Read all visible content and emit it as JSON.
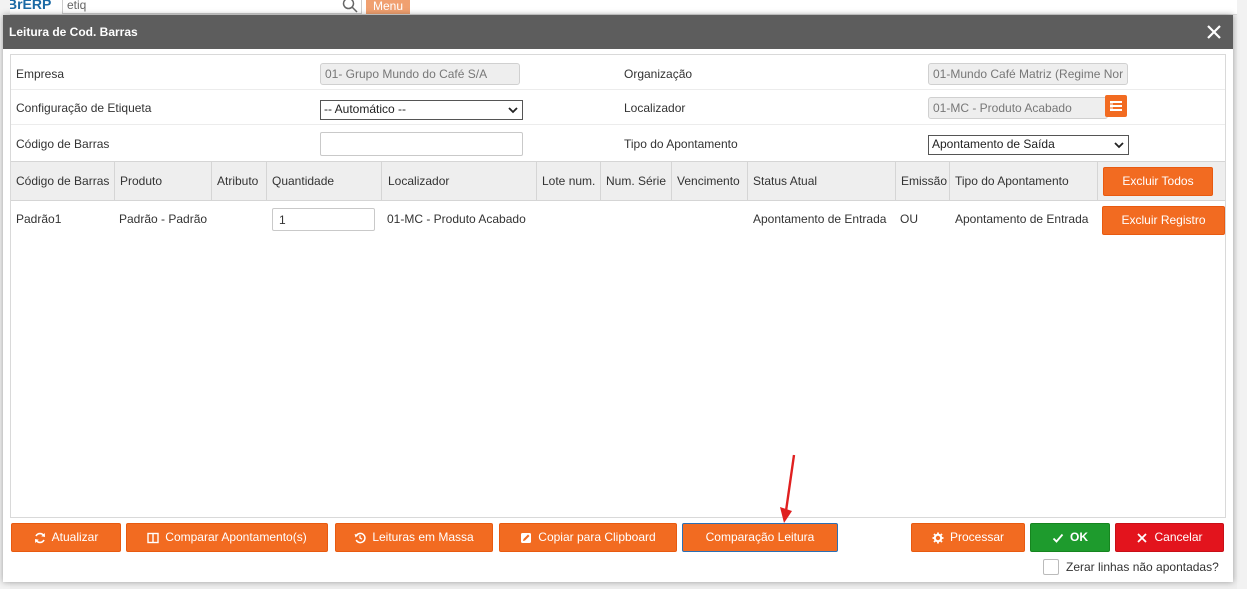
{
  "background": {
    "logo": "BrERP",
    "search_value": "etiq",
    "menu_label": "Menu"
  },
  "dialog": {
    "title": "Leitura de Cod. Barras",
    "close_icon": "close-icon"
  },
  "form": {
    "empresa_label": "Empresa",
    "empresa_value": "01- Grupo Mundo do Café S/A",
    "organizacao_label": "Organização",
    "organizacao_value": "01-Mundo Café Matriz (Regime Nor",
    "config_etiqueta_label": "Configuração de Etiqueta",
    "config_etiqueta_value": "-- Automático --",
    "localizador_label": "Localizador",
    "localizador_value": "01-MC - Produto Acabado",
    "localizador_button_icon": "list-icon",
    "codigo_barras_label": "Código de Barras",
    "codigo_barras_value": "",
    "tipo_apontamento_label": "Tipo do Apontamento",
    "tipo_apontamento_value": "Apontamento de Saída"
  },
  "table": {
    "columns": [
      "Código de Barras",
      "Produto",
      "Atributo",
      "Quantidade",
      "Localizador",
      "Lote num.",
      "Num. Série",
      "Vencimento",
      "Status Atual",
      "Emissão",
      "Tipo do Apontamento"
    ],
    "delete_all_label": "Excluir Todos",
    "rows": [
      {
        "codigo": "Padrão1",
        "produto": "Padrão - Padrão",
        "atributo": "",
        "quantidade": "1",
        "localizador": "01-MC - Produto Acabado",
        "lote": "",
        "serie": "",
        "vencimento": "",
        "status": "Apontamento de Entrada",
        "emissao": "OU",
        "tipo": "Apontamento de Entrada",
        "delete_label": "Excluir Registro"
      }
    ]
  },
  "footer": {
    "atualizar": "Atualizar",
    "comparar": "Comparar Apontamento(s)",
    "leituras_massa": "Leituras em Massa",
    "copiar": "Copiar para Clipboard",
    "comparacao_leitura": "Comparação Leitura",
    "processar": "Processar",
    "ok": "OK",
    "cancelar": "Cancelar",
    "zerar_label": "Zerar linhas não apontadas?",
    "zerar_checked": false
  },
  "colors": {
    "accent_orange": "#f26b21",
    "ok_green": "#1e9b2d",
    "cancel_red": "#e3141d",
    "header_gray": "#5d5d5d",
    "annotation_red": "#e02020"
  }
}
